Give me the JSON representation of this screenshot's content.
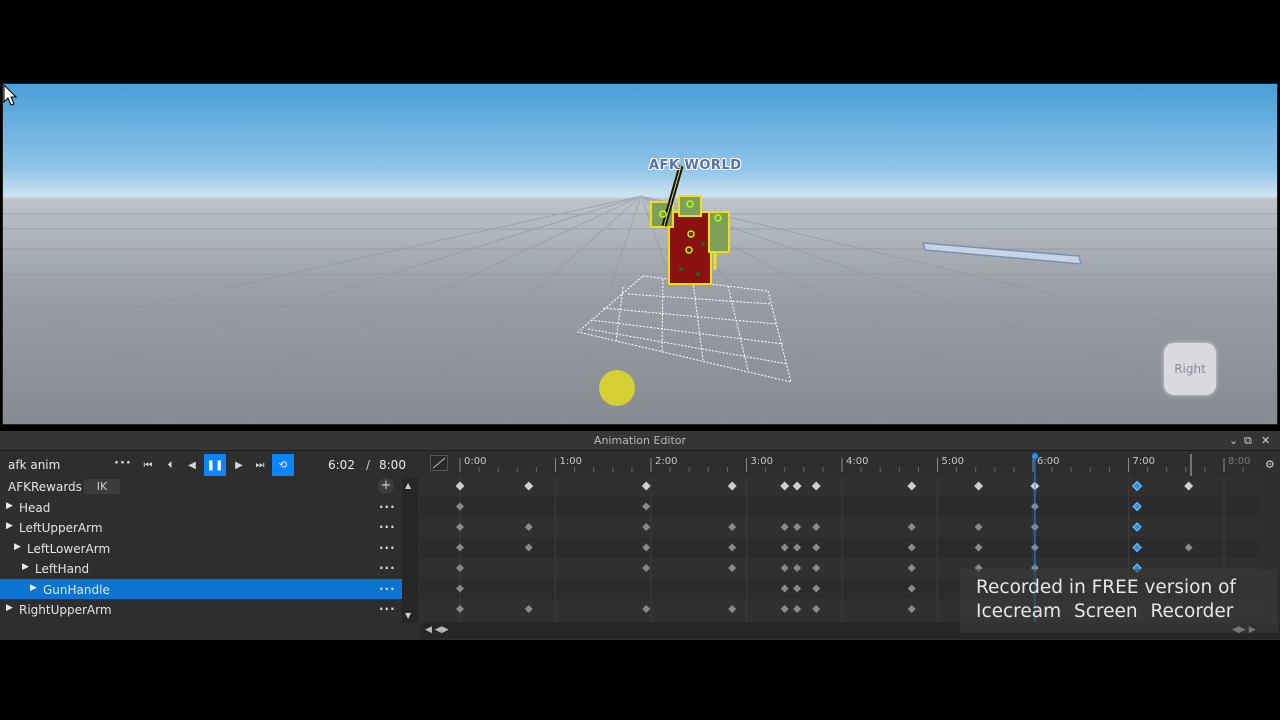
{
  "viewport": {
    "billboard_text": "AFK WORLD",
    "view_cube_label": "Right"
  },
  "editor": {
    "title": "Animation Editor",
    "animation_name": "afk anim",
    "time_current": "6:02",
    "time_separator": "/",
    "time_end": "8:00",
    "tracks_header": "AFKRewards",
    "ik_label": "IK",
    "tracks": [
      {
        "label": "Head",
        "level": 0,
        "expandable": true,
        "selected": false
      },
      {
        "label": "LeftUpperArm",
        "level": 0,
        "expandable": true,
        "selected": false
      },
      {
        "label": "LeftLowerArm",
        "level": 1,
        "expandable": true,
        "selected": false
      },
      {
        "label": "LeftHand",
        "level": 2,
        "expandable": true,
        "selected": false
      },
      {
        "label": "GunHandle",
        "level": 3,
        "expandable": true,
        "selected": true
      },
      {
        "label": "RightUpperArm",
        "level": 0,
        "expandable": true,
        "selected": false
      }
    ],
    "ruler_labels": [
      "0:00",
      "1:00",
      "2:00",
      "3:00",
      "4:00",
      "5:00",
      "6:00",
      "7:00",
      "8:00"
    ],
    "colors": {
      "accent": "#0a84ff",
      "selected_row": "#0a74d0",
      "scrubber": "#1e90ff",
      "keyframe": "#cfcfcf",
      "keyframe_dim": "#8a8a8a",
      "keyframe_selected": "#2a8fe0"
    }
  },
  "watermark": {
    "line1": "Recorded in FREE version of",
    "line2": "Icecream Screen Recorder"
  }
}
